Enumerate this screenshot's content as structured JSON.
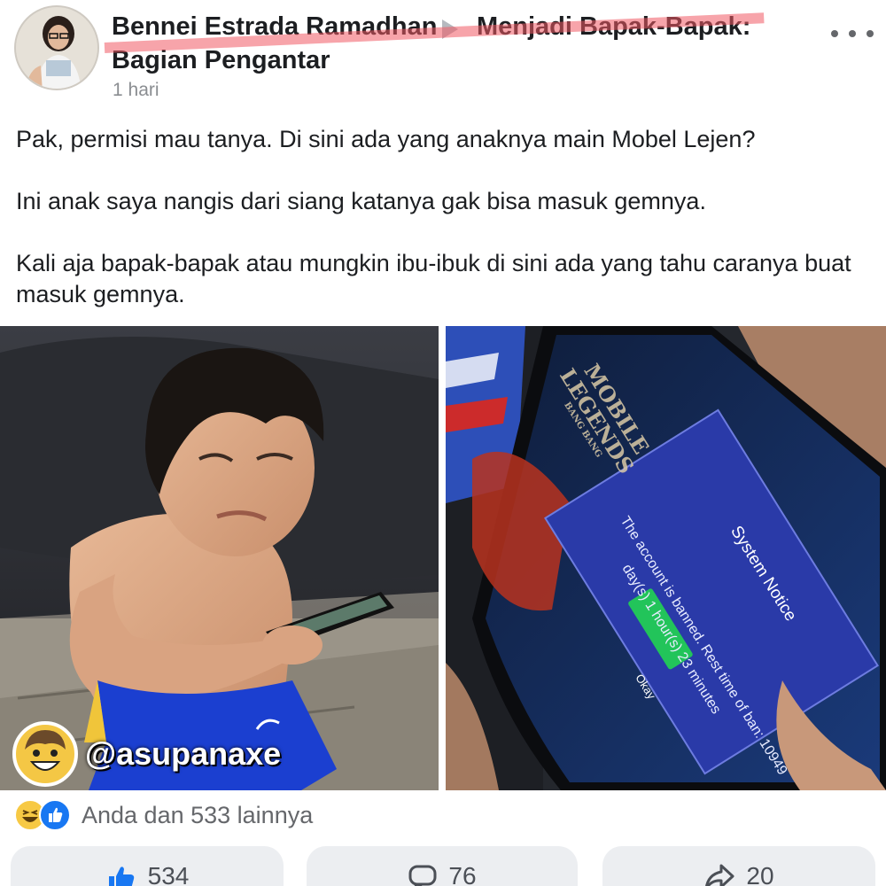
{
  "post": {
    "author": "Bennei Estrada Ramadhan",
    "group_line1": "Menjadi Bapak-Bapak:",
    "group_line2": "Bagian Pengantar",
    "time": "1 hari",
    "paragraphs": [
      "Pak, permisi mau tanya. Di sini ada yang anaknya main Mobel Lejen?",
      "Ini anak saya nangis dari siang katanya gak bisa masuk gemnya.",
      "Kali aja bapak-bapak atau mungkin ibu-ibuk di sini ada yang tahu caranya buat masuk gemnya."
    ]
  },
  "photo_right": {
    "game_logo_line1": "MOBILE",
    "game_logo_line2": "LEGENDS",
    "game_logo_sub": "BANG BANG",
    "notice_title": "System Notice",
    "notice_body_1": "The account is banned. Rest time of ban: 10949",
    "notice_body_2": "day(s) 1 hour(s) 23 minutes",
    "notice_button": "Okay"
  },
  "watermark": {
    "handle": "@asupanaxe"
  },
  "reactions": {
    "summary": "Anda dan 533 lainnya",
    "types": [
      "haha-icon",
      "like-icon"
    ]
  },
  "actions": {
    "like_count": "534",
    "comment_count": "76",
    "share_count": "20"
  },
  "colors": {
    "like_blue": "#1877f2",
    "haha_yellow": "#f7c944",
    "strike_red": "#f05a64",
    "notice_blue": "#2a3aa8",
    "okay_green": "#22c45a"
  }
}
